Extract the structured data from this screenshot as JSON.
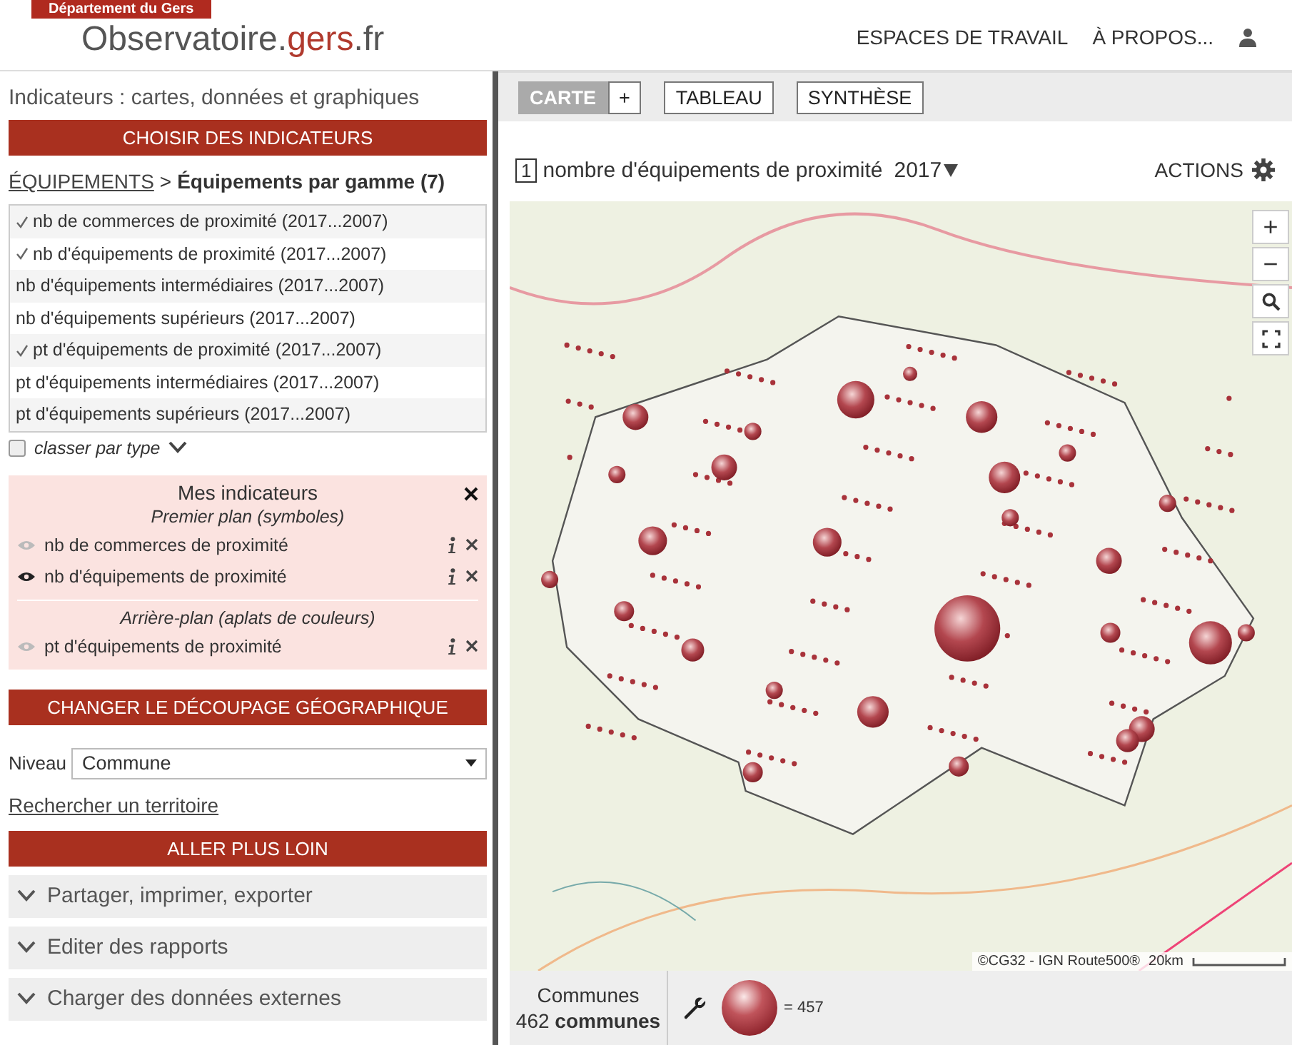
{
  "header": {
    "department": "Département du Gers",
    "logo_main": "Observatoire.",
    "logo_accent": "gers",
    "logo_end": ".fr",
    "nav": [
      "ESPACES DE TRAVAIL",
      "À PROPOS..."
    ]
  },
  "sidebar": {
    "title": "Indicateurs : cartes, données et graphiques",
    "choose_button": "CHOISIR DES INDICATEURS",
    "breadcrumb_link": "ÉQUIPEMENTS",
    "breadcrumb_sep": ">",
    "breadcrumb_current": "Équipements par gamme (7)",
    "indicators": [
      {
        "label": "nb de commerces de proximité (2017...2007)",
        "checked": true
      },
      {
        "label": "nb d'équipements de proximité (2017...2007)",
        "checked": true
      },
      {
        "label": "nb d'équipements intermédiaires (2017...2007)",
        "checked": false
      },
      {
        "label": "nb d'équipements supérieurs (2017...2007)",
        "checked": false
      },
      {
        "label": "pt d'équipements de proximité (2017...2007)",
        "checked": true
      },
      {
        "label": "pt d'équipements intermédiaires (2017...2007)",
        "checked": false
      },
      {
        "label": "pt d'équipements supérieurs (2017...2007)",
        "checked": false
      }
    ],
    "sort_by_type": {
      "label": "classer par type",
      "checked": false
    },
    "my_indicators": {
      "title": "Mes indicateurs",
      "groups": [
        {
          "title": "Premier plan (symboles)",
          "items": [
            {
              "label": "nb de commerces de proximité",
              "visible": false
            },
            {
              "label": "nb d'équipements de proximité",
              "visible": true
            }
          ]
        },
        {
          "title": "Arrière-plan (aplats de couleurs)",
          "items": [
            {
              "label": "pt d'équipements de proximité",
              "visible": false
            }
          ]
        }
      ]
    },
    "geo_button": "CHANGER LE DÉCOUPAGE GÉOGRAPHIQUE",
    "level_label": "Niveau",
    "level_value": "Commune",
    "search_link": "Rechercher un territoire",
    "more_button": "ALLER PLUS LOIN",
    "accordions": [
      {
        "label": "Partager, imprimer, exporter",
        "expanded": false
      },
      {
        "label": "Editer des rapports",
        "expanded": false
      },
      {
        "label": "Charger des données externes",
        "expanded": false
      }
    ]
  },
  "main": {
    "tabs": [
      {
        "label": "CARTE",
        "selected": true
      },
      {
        "label": "+",
        "selected": false
      },
      {
        "label": "TABLEAU",
        "selected": false
      },
      {
        "label": "SYNTHÈSE",
        "selected": false
      }
    ],
    "map_index": "1",
    "map_title": "nombre d'équipements de proximité",
    "year": "2017",
    "actions": "ACTIONS",
    "zoom_in": "+",
    "zoom_out": "−",
    "attribution": "©CG32 - IGN Route500®",
    "scale": "20km",
    "legend": {
      "unit_title": "Communes",
      "count": "462",
      "count_unit": "communes",
      "symbol_value": "= 457"
    }
  }
}
